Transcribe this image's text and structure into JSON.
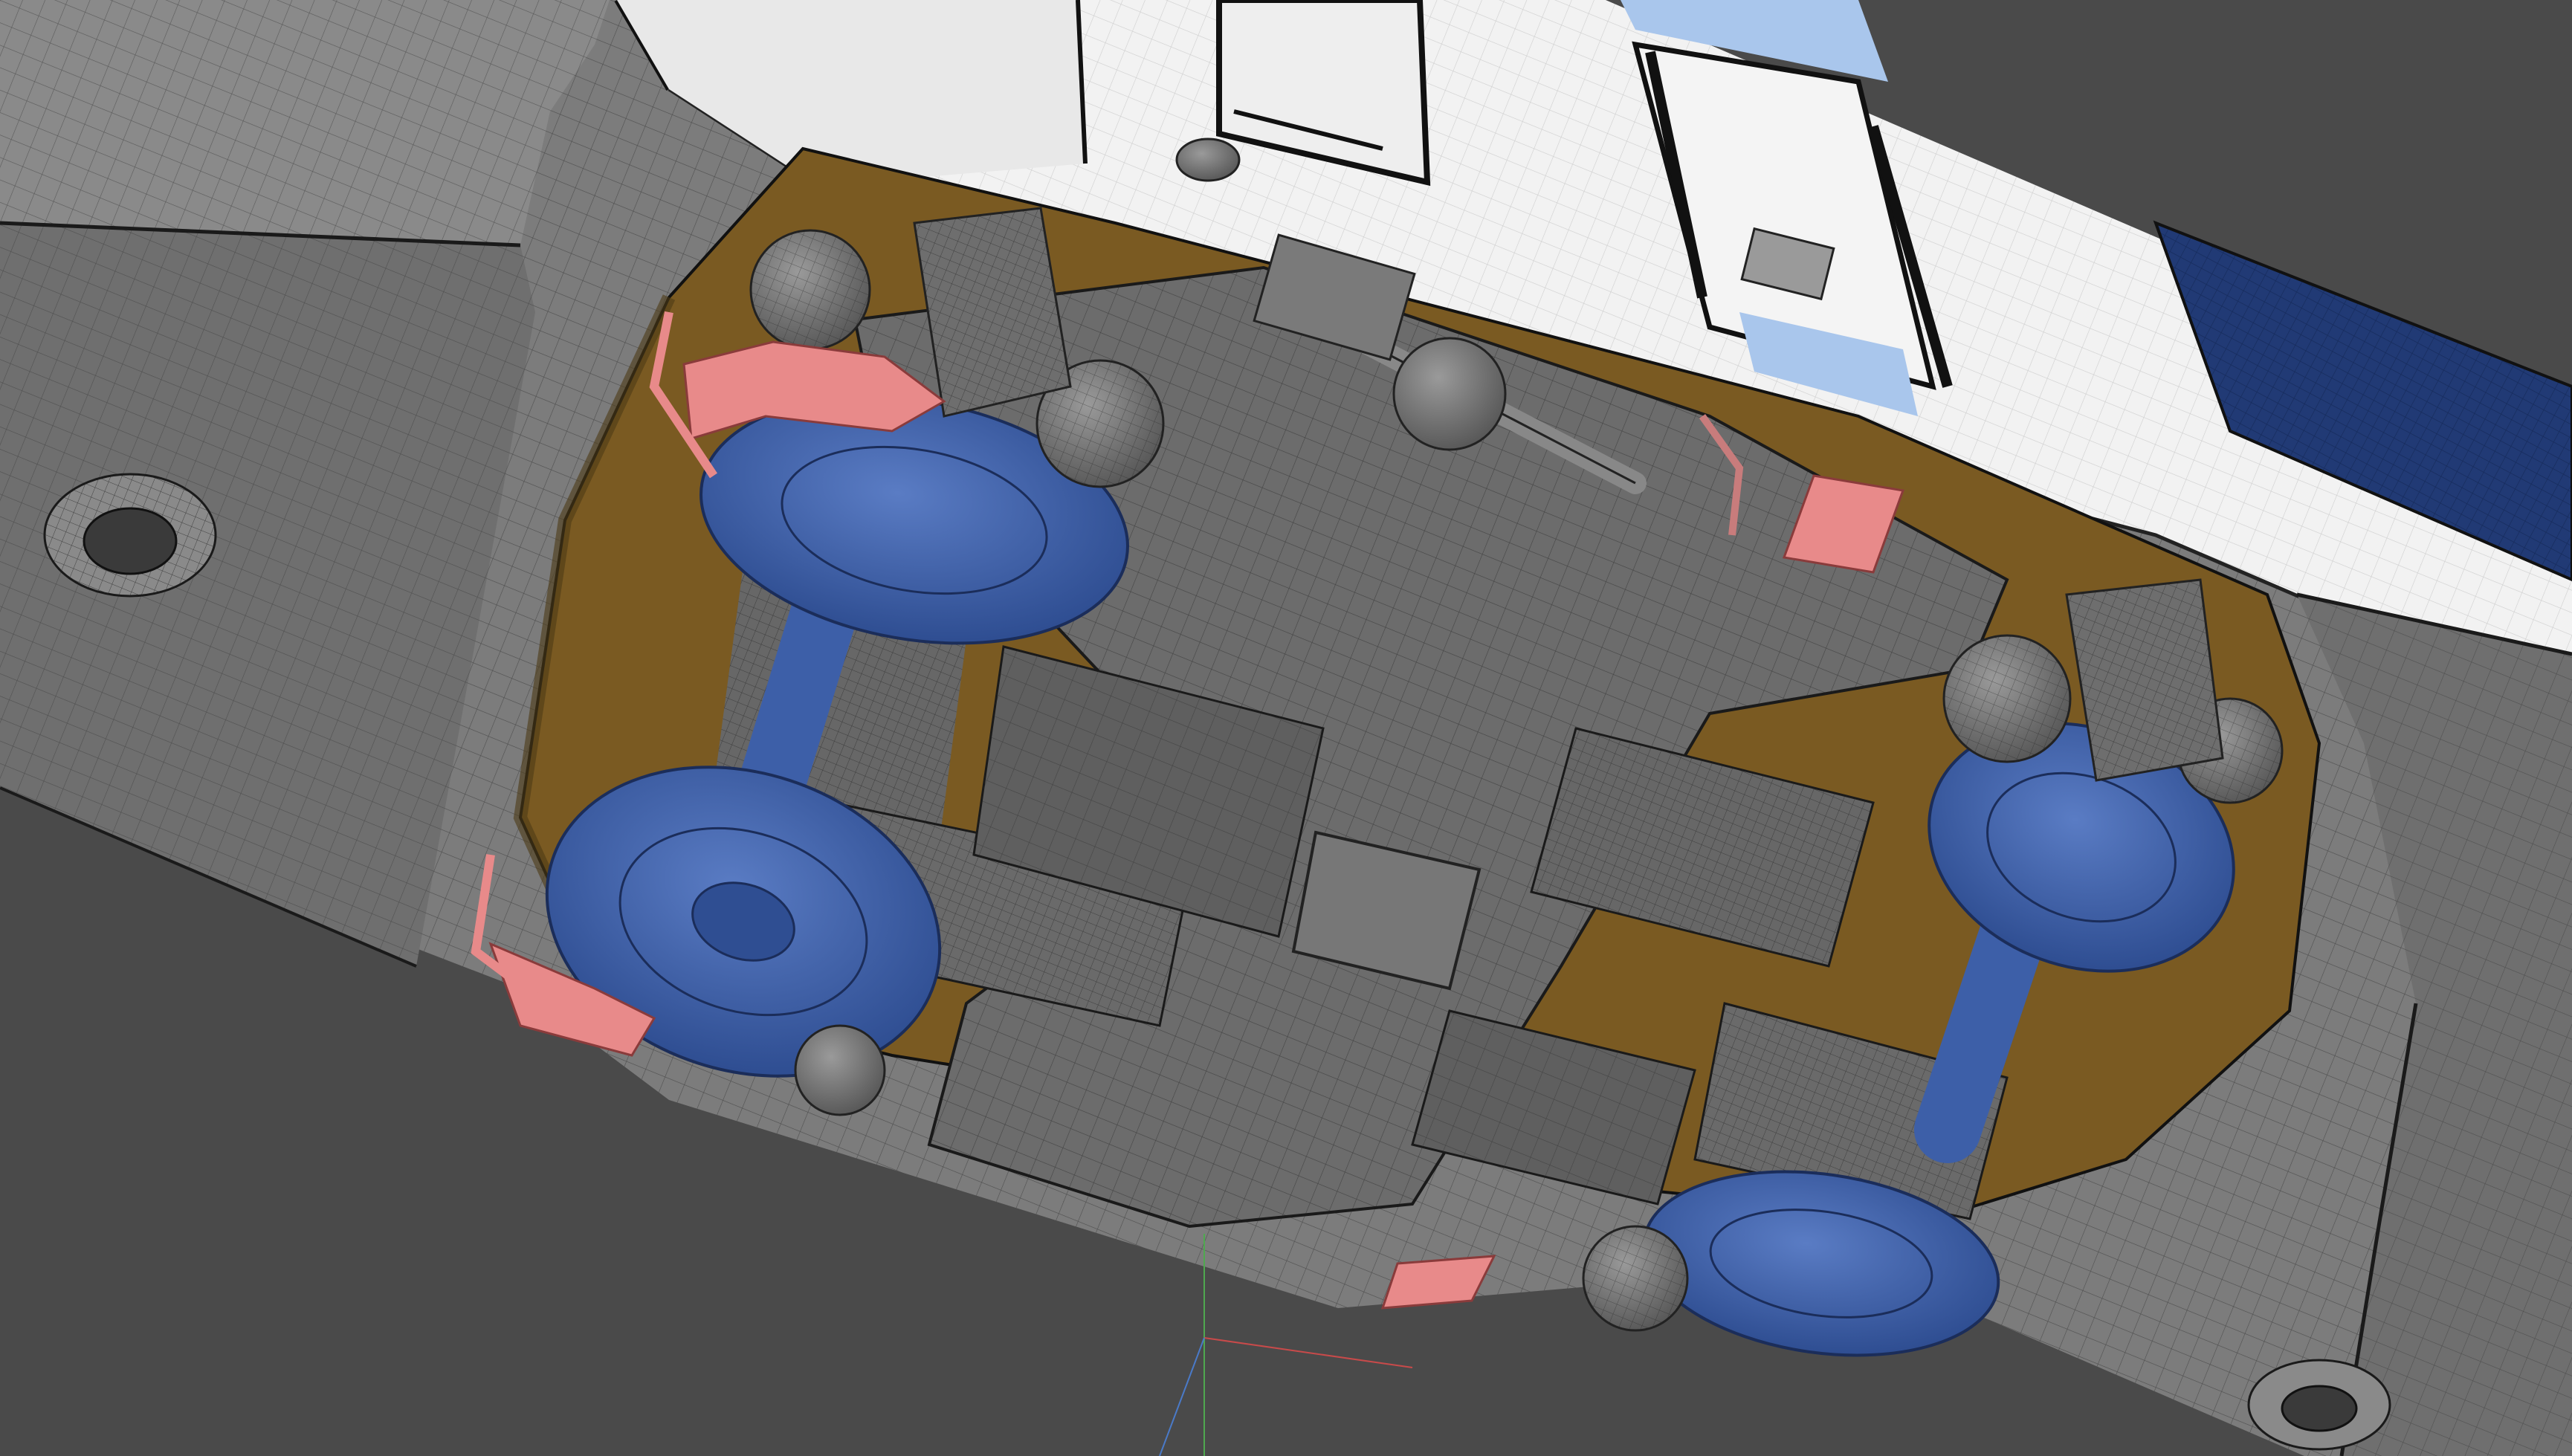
{
  "viewport": {
    "kind": "3d-modeling-viewport",
    "shading": "solid-with-wireframe",
    "background_color": "#4a4a4a",
    "colors": {
      "car_body": "#7a7a7a",
      "car_body_dark": "#5f5f5f",
      "livery_white": "#f2f2f2",
      "wheel_blue": "#3d5fa8",
      "stripe_navy": "#213a75",
      "bogie_frame": "#6c6c6c",
      "undercarriage_brown": "#7a5a22",
      "sand_pipe_pink": "#e88a8a",
      "window_light_blue": "#a9c6ec",
      "wire": "#1d1d1d"
    },
    "icons": {
      "axis_gizmo": "axis-gizmo-icon"
    },
    "model_parts": [
      "car-body",
      "bogie-frame",
      "wheelset",
      "axlebox",
      "traction-motor",
      "gearbox",
      "sanding-pipe",
      "step-plate",
      "door",
      "window"
    ]
  }
}
